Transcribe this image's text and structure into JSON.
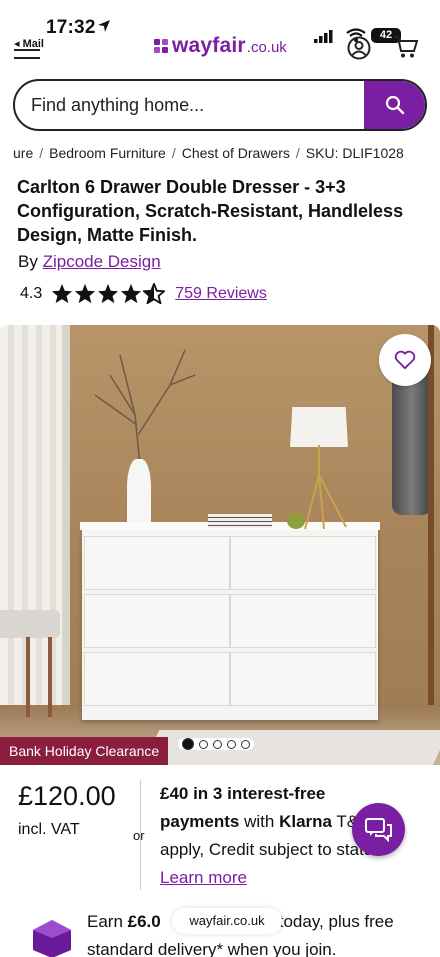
{
  "status_bar": {
    "time": "17:32",
    "back_app": "◂ Mail",
    "battery": "42"
  },
  "header": {
    "brand": "wayfair",
    "brand_tld": ".co.uk"
  },
  "search": {
    "placeholder": "Find anything home..."
  },
  "breadcrumb": {
    "items": [
      "ure",
      "Bedroom Furniture",
      "Chest of Drawers",
      "SKU: DLIF1028"
    ]
  },
  "product": {
    "title": "Carlton 6 Drawer Double Dresser - 3+3 Configuration, Scratch-Resistant, Handleless Design, Matte Finish.",
    "by_prefix": "By",
    "brand_link": "Zipcode Design",
    "rating": "4.3",
    "rating_stars": 4.3,
    "reviews": "759 Reviews"
  },
  "gallery": {
    "badge": "Bank Holiday Clearance",
    "image_count": 5,
    "active_index": 0
  },
  "pricing": {
    "price": "£120.00",
    "vat": "incl. VAT",
    "or": "or",
    "klarna_line1": "£40 in 3 interest-free",
    "klarna_line2_bold": "payments",
    "klarna_line2_rest": " with ",
    "klarna_brand": "Klarna",
    "klarna_line2_tail": " T&C",
    "klarna_line3": "apply, Credit subject to s",
    "klarna_line3_tail": "tatus.",
    "learn_more": "Learn more"
  },
  "rewards": {
    "earn_prefix": "Earn ",
    "earn_amount": "£6.0",
    "earn_rest": "today, plus free",
    "line2": "standard delivery* when you join."
  },
  "browser": {
    "url": "wayfair.co.uk"
  },
  "colors": {
    "accent": "#7b1fa2",
    "badge": "#8b1e3f"
  }
}
